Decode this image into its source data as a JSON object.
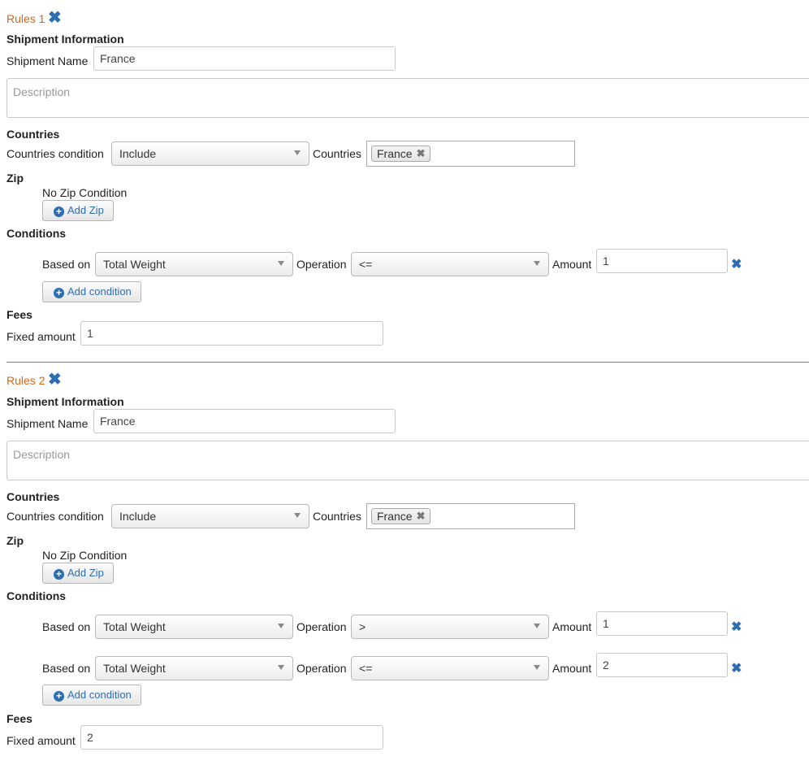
{
  "rules": [
    {
      "title": "Rules 1",
      "shipment_section": "Shipment Information",
      "shipment_name_label": "Shipment Name",
      "shipment_name_value": "France",
      "description_placeholder": "Description",
      "countries_section": "Countries",
      "countries_condition_label": "Countries condition",
      "countries_condition_value": "Include",
      "countries_label": "Countries",
      "countries_tag": "France",
      "zip_section": "Zip",
      "zip_status": "No Zip Condition",
      "add_zip_label": "Add Zip",
      "conditions_section": "Conditions",
      "conditions": [
        {
          "based_on_label": "Based on",
          "based_on_value": "Total Weight",
          "operation_label": "Operation",
          "operation_value": "<=",
          "amount_label": "Amount",
          "amount_value": "1"
        }
      ],
      "add_condition_label": "Add condition",
      "fees_section": "Fees",
      "fixed_amount_label": "Fixed amount",
      "fixed_amount_value": "1"
    },
    {
      "title": "Rules 2",
      "shipment_section": "Shipment Information",
      "shipment_name_label": "Shipment Name",
      "shipment_name_value": "France",
      "description_placeholder": "Description",
      "countries_section": "Countries",
      "countries_condition_label": "Countries condition",
      "countries_condition_value": "Include",
      "countries_label": "Countries",
      "countries_tag": "France",
      "zip_section": "Zip",
      "zip_status": "No Zip Condition",
      "add_zip_label": "Add Zip",
      "conditions_section": "Conditions",
      "conditions": [
        {
          "based_on_label": "Based on",
          "based_on_value": "Total Weight",
          "operation_label": "Operation",
          "operation_value": ">",
          "amount_label": "Amount",
          "amount_value": "1"
        },
        {
          "based_on_label": "Based on",
          "based_on_value": "Total Weight",
          "operation_label": "Operation",
          "operation_value": "<=",
          "amount_label": "Amount",
          "amount_value": "2"
        }
      ],
      "add_condition_label": "Add condition",
      "fees_section": "Fees",
      "fixed_amount_label": "Fixed amount",
      "fixed_amount_value": "2"
    }
  ],
  "colors": {
    "rule_title": "#d2691e",
    "icon_blue": "#2e6db0",
    "divider": "#d9534f"
  },
  "icons": {
    "remove_rule": "close-icon",
    "add": "plus-circle-icon",
    "remove_condition": "close-icon",
    "tag_remove": "close-icon",
    "dropdown": "caret-down-icon"
  }
}
